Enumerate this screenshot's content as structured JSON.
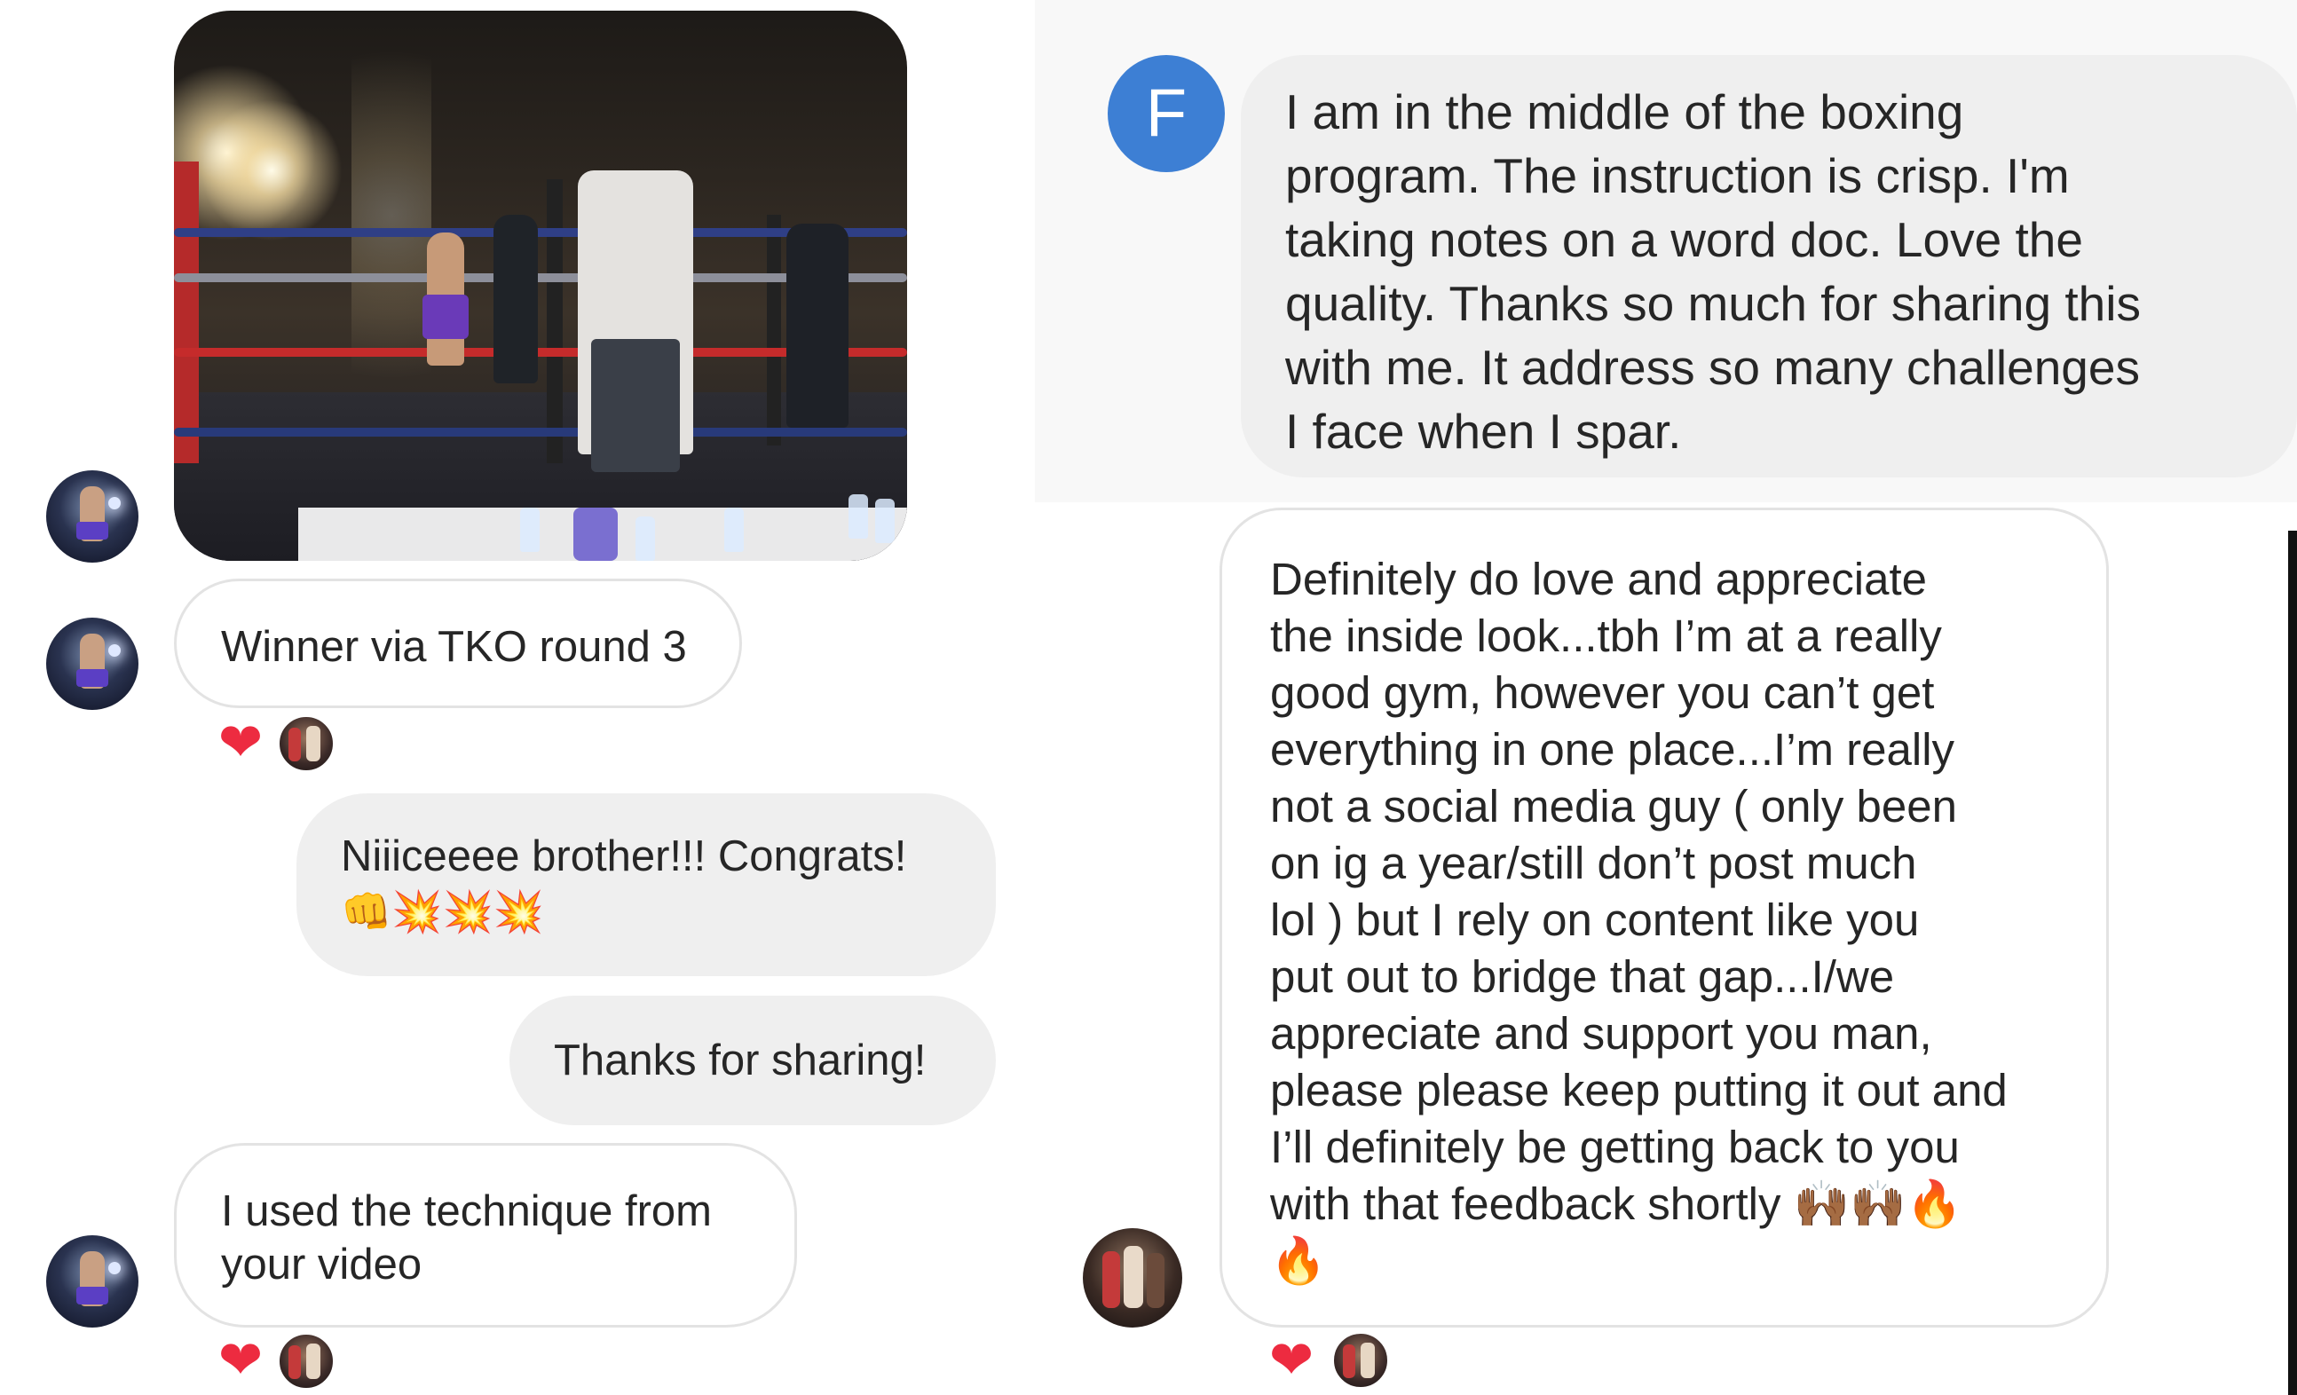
{
  "left_thread": {
    "photo_alt": "",
    "messages": [
      {
        "text": "Winner via TKO round 3",
        "direction": "incoming"
      },
      {
        "text": "Niiiceeee brother!!! Congrats!",
        "emoji": "👊💥💥💥",
        "direction": "outgoing"
      },
      {
        "text": "Thanks for sharing!",
        "direction": "outgoing"
      },
      {
        "text_line1": "I used the technique from",
        "text_line2": "your video",
        "direction": "incoming"
      }
    ],
    "reaction_heart": "❤"
  },
  "right_thread": {
    "sender_initial": "F",
    "message_lines": [
      "I am in the middle of the boxing",
      "program. The instruction is crisp. I'm",
      "taking notes on a word doc. Love the",
      "quality. Thanks so much for sharing this",
      "with me. It address so many challenges",
      "I face when I spar."
    ],
    "reply_lines": [
      "Definitely do love and appreciate",
      "the inside look...tbh I’m at a really",
      "good gym, however you can’t get",
      "everything in one place...I’m really",
      "not a social media guy ( only been",
      "on ig a year/still don’t post much",
      "lol ) but I rely on content like you",
      "put out to bridge that gap...I/we",
      "appreciate and support you man,",
      "please please keep putting it out and",
      "I’ll definitely be getting back to you",
      "with that feedback shortly 🙌🏾🙌🏾🔥",
      "🔥"
    ]
  },
  "icons": {
    "heart": "heart-icon",
    "avatar": "avatar"
  },
  "colors": {
    "heart": "#ed2b40",
    "incoming_border": "#e3e3e3",
    "outgoing_bg": "#efefef",
    "f_avatar": "#3d7fd4"
  }
}
